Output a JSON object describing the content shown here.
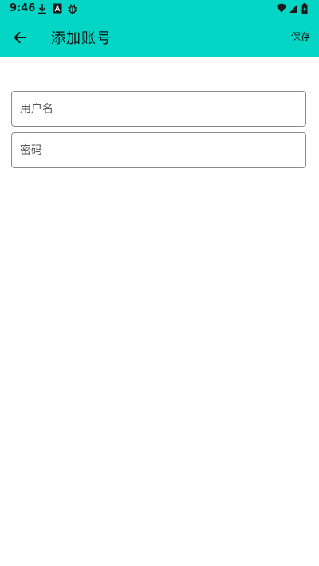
{
  "status_bar": {
    "time": "9:46",
    "icons": [
      "download-icon",
      "font-box-icon",
      "bug-icon",
      "wifi-icon",
      "cell-signal-icon",
      "battery-charging-icon"
    ]
  },
  "toolbar": {
    "title": "添加账号",
    "save_label": "保存",
    "back_icon": "arrow-left-icon"
  },
  "form": {
    "username_placeholder": "用户名",
    "username_value": "",
    "password_placeholder": "密码",
    "password_value": ""
  },
  "colors": {
    "appbar": "#03d6c4",
    "background": "#ffffff",
    "field_border": "#8a8a8a"
  }
}
